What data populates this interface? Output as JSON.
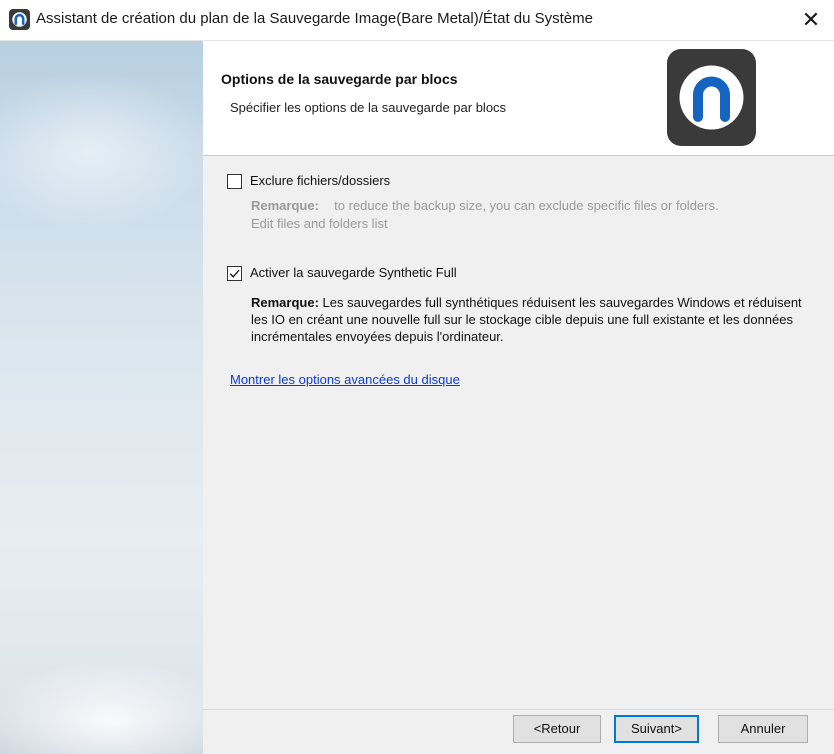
{
  "window": {
    "title": "Assistant de création du plan de la Sauvegarde Image(Bare Metal)/État du Système",
    "close_glyph": "✕",
    "app_icon": "storage-app-icon"
  },
  "header": {
    "title": "Options de la sauvegarde par blocs",
    "subtitle": "Spécifier les options de la sauvegarde par blocs",
    "logo": "brand-logo-icon"
  },
  "options": {
    "exclude": {
      "label": "Exclure fichiers/dossiers",
      "checked": false,
      "note_label": "Remarque:",
      "note_text": "to reduce the backup size, you can exclude specific files or folders.",
      "note_link": "Edit files and folders list"
    },
    "synthetic": {
      "label": "Activer la sauvegarde Synthetic Full",
      "checked": true,
      "note_label": "Remarque:",
      "note_text": "Les sauvegardes full synthétiques réduisent les sauvegardes Windows et réduisent les IO en créant une nouvelle full sur le stockage cible depuis une full existante et les données incrémentales envoyées depuis l'ordinateur."
    },
    "advanced_link": "Montrer les options avancées du disque"
  },
  "footer": {
    "back_label": "<Retour",
    "next_label": "Suivant>",
    "cancel_label": "Annuler"
  },
  "colors": {
    "accent": "#0078d7",
    "link": "#0a3ad6",
    "logo_bg": "#3a3a3a",
    "logo_mark": "#1565c0"
  }
}
